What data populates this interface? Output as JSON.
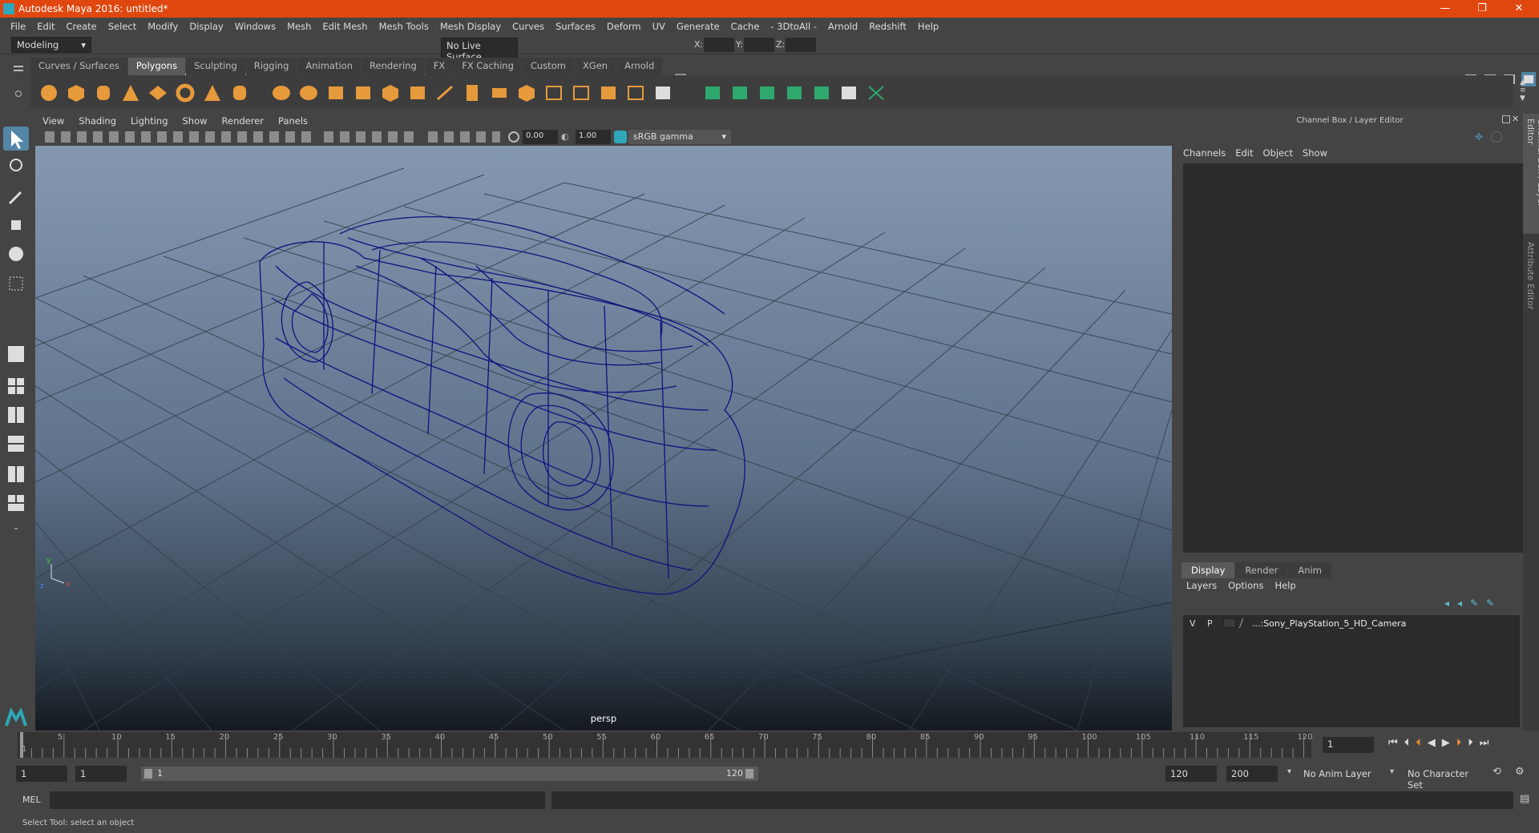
{
  "titlebar": {
    "title": "Autodesk Maya 2016: untitled*",
    "minimize": "—",
    "restore": "❐",
    "close": "✕"
  },
  "menus": [
    "File",
    "Edit",
    "Create",
    "Select",
    "Modify",
    "Display",
    "Windows",
    "Mesh",
    "Edit Mesh",
    "Mesh Tools",
    "Mesh Display",
    "Curves",
    "Surfaces",
    "Deform",
    "UV",
    "Generate",
    "Cache",
    "- 3DtoAll -",
    "Arnold",
    "Redshift",
    "Help"
  ],
  "statusline": {
    "mode": "Modeling",
    "live_surface": "No Live Surface",
    "x_label": "X:",
    "y_label": "Y:",
    "z_label": "Z:"
  },
  "shelf_tabs": [
    "Curves / Surfaces",
    "Polygons",
    "Sculpting",
    "Rigging",
    "Animation",
    "Rendering",
    "FX",
    "FX Caching",
    "Custom",
    "XGen",
    "Arnold"
  ],
  "active_shelf_tab": "Polygons",
  "viewport": {
    "menus": [
      "View",
      "Shading",
      "Lighting",
      "Show",
      "Renderer",
      "Panels"
    ],
    "exposure": "0.00",
    "gamma": "1.00",
    "color_space": "sRGB gamma",
    "camera_label": "persp"
  },
  "channel_box": {
    "title": "Channel Box / Layer Editor",
    "menus": [
      "Channels",
      "Edit",
      "Object",
      "Show"
    ]
  },
  "layer_editor": {
    "tabs": [
      "Display",
      "Render",
      "Anim"
    ],
    "active_tab": "Display",
    "menus": [
      "Layers",
      "Options",
      "Help"
    ],
    "layer": {
      "v": "V",
      "p": "P",
      "name": "...:Sony_PlayStation_5_HD_Camera"
    }
  },
  "side_tabs": [
    "Channel Box / Layer Editor",
    "Attribute Editor"
  ],
  "timeline": {
    "ticks": [
      "5",
      "10",
      "15",
      "20",
      "25",
      "30",
      "35",
      "40",
      "45",
      "50",
      "55",
      "60",
      "65",
      "70",
      "75",
      "80",
      "85",
      "90",
      "95",
      "100",
      "105",
      "110",
      "115",
      "120"
    ],
    "start_marker": "1",
    "current_frame": "1"
  },
  "range": {
    "start": "1",
    "playback_start": "1",
    "slider_start": "1",
    "slider_end": "120",
    "playback_end": "120",
    "end": "200",
    "anim_layer": "No Anim Layer",
    "character_set": "No Character Set"
  },
  "mel": {
    "label": "MEL"
  },
  "helpline": {
    "text": "Select Tool: select an object"
  },
  "colors": {
    "titlebar": "#e0470f",
    "wireframe": "#0d0d7a",
    "accent": "#5285a6"
  }
}
